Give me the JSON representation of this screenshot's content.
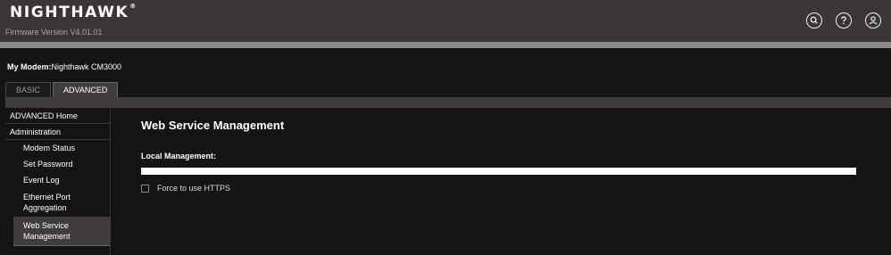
{
  "header": {
    "brand": "NIGHTHAWK",
    "trademark": "®",
    "firmware": "Firmware Version V4.01.01",
    "icons": [
      "search-icon",
      "help-icon",
      "user-icon"
    ]
  },
  "modem": {
    "label": "My Modem:",
    "name": "Nighthawk CM3000"
  },
  "tabs": [
    {
      "label": "BASIC",
      "active": false
    },
    {
      "label": "ADVANCED",
      "active": true
    }
  ],
  "sidebar": {
    "home": "ADVANCED Home",
    "section": "Administration",
    "items": [
      {
        "label": "Modem Status"
      },
      {
        "label": "Set Password"
      },
      {
        "label": "Event Log"
      },
      {
        "label": "Ethernet Port Aggregation"
      },
      {
        "label": "Web Service Management",
        "active": true
      }
    ]
  },
  "main": {
    "title": "Web Service Management",
    "local_management_label": "Local Management:",
    "force_https_label": "Force to use HTTPS",
    "force_https_checked": false
  }
}
